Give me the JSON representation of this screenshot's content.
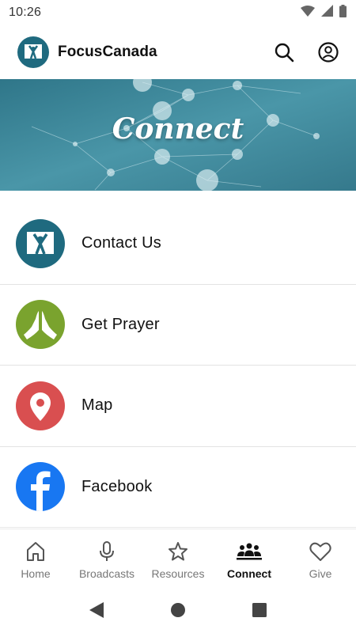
{
  "status_bar": {
    "time": "10:26",
    "icons": [
      "wifi-icon",
      "signal-icon",
      "battery-icon"
    ]
  },
  "app_bar": {
    "title": "FocusCanada",
    "logo_icon": "focus-logo-icon",
    "actions": [
      "search-icon",
      "account-icon"
    ]
  },
  "banner": {
    "title": "Connect",
    "color": "#3d8a9e"
  },
  "list": {
    "items": [
      {
        "label": "Contact Us",
        "icon": "focus-logo-icon",
        "color": "#1f6a7f"
      },
      {
        "label": "Get Prayer",
        "icon": "praying-hands-icon",
        "color": "#7aa32e"
      },
      {
        "label": "Map",
        "icon": "map-pin-icon",
        "color": "#d94f50"
      },
      {
        "label": "Facebook",
        "icon": "facebook-icon",
        "color": "#1877f2"
      }
    ]
  },
  "bottom_nav": {
    "items": [
      {
        "label": "Home",
        "icon": "home-icon",
        "active": false
      },
      {
        "label": "Broadcasts",
        "icon": "microphone-icon",
        "active": false
      },
      {
        "label": "Resources",
        "icon": "star-icon",
        "active": false
      },
      {
        "label": "Connect",
        "icon": "people-icon",
        "active": true
      },
      {
        "label": "Give",
        "icon": "heart-icon",
        "active": false
      }
    ]
  },
  "system_nav": [
    "back-icon",
    "home-circle-icon",
    "recents-icon"
  ]
}
